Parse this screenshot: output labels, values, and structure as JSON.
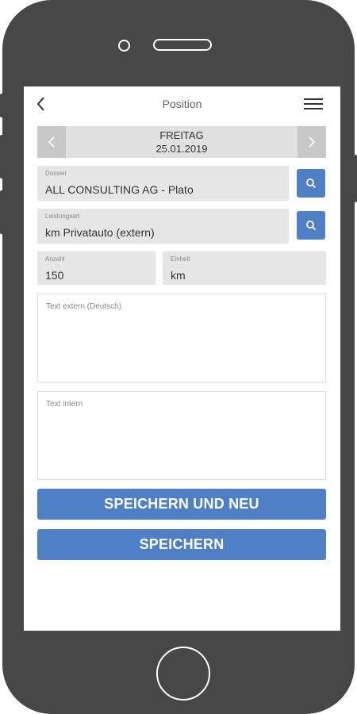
{
  "header": {
    "title": "Position"
  },
  "date": {
    "day": "FREITAG",
    "date": "25.01.2019"
  },
  "fields": {
    "dossier": {
      "label": "Dossier",
      "value": "ALL CONSULTING AG - Plato"
    },
    "leistungsart": {
      "label": "Leistungsart",
      "value": "km Privatauto (extern)"
    },
    "anzahl": {
      "label": "Anzahl",
      "value": "150"
    },
    "einheit": {
      "label": "Einheit",
      "value": "km"
    },
    "text_extern": {
      "label": "Text extern (Deutsch)"
    },
    "text_intern": {
      "label": "Text intern"
    }
  },
  "buttons": {
    "save_and_new": "SPEICHERN UND NEU",
    "save": "SPEICHERN"
  },
  "colors": {
    "accent": "#4f7fc5",
    "frame": "#474747",
    "field_bg": "#e6e6e6"
  },
  "icons": [
    "back-icon",
    "menu-icon",
    "chevron-left-icon",
    "chevron-right-icon",
    "search-icon"
  ]
}
